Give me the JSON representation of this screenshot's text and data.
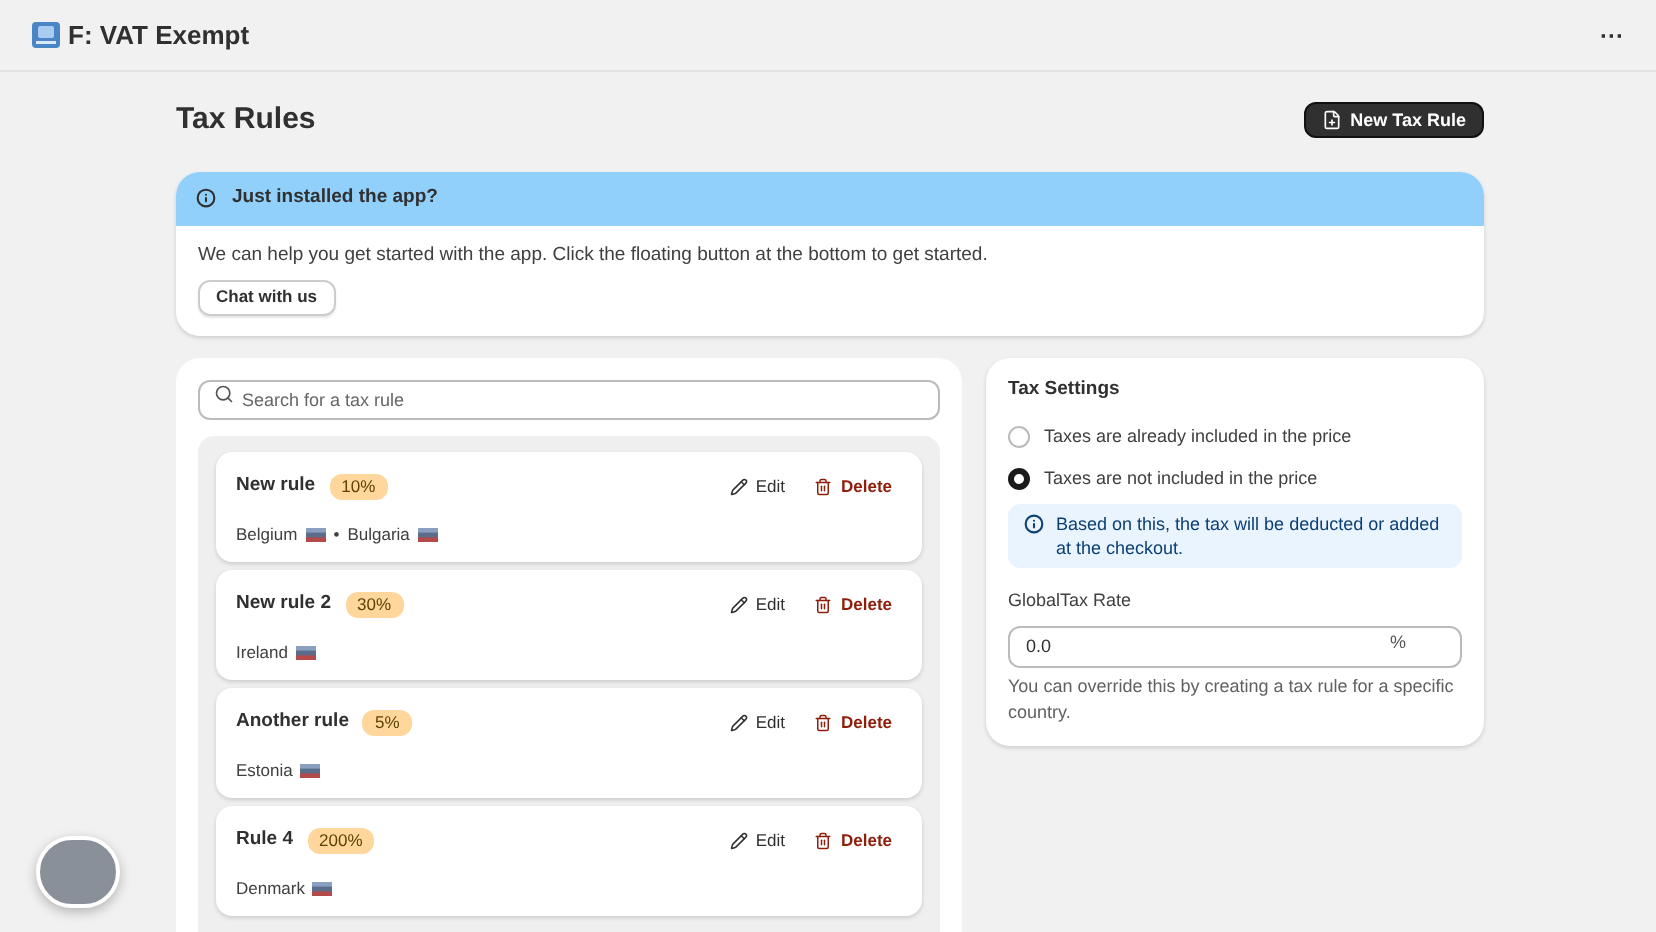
{
  "window": {
    "title": "F: VAT Exempt",
    "menu_icon": "···"
  },
  "page": {
    "title": "Tax Rules",
    "primary_action": "New Tax Rule"
  },
  "banner": {
    "title": "Just installed the app?",
    "body": "We can help you get started with the app. Click the floating button at the bottom to get started.",
    "action": "Chat with us"
  },
  "search": {
    "placeholder": "Search for a tax rule"
  },
  "rules": [
    {
      "name": "New rule",
      "rate": "10%",
      "edit": "Edit",
      "delete": "Delete",
      "countries": [
        "Belgium",
        "Bulgaria"
      ],
      "separators": [
        "•"
      ]
    },
    {
      "name": "New rule 2",
      "rate": "30%",
      "edit": "Edit",
      "delete": "Delete",
      "countries": [
        "Ireland"
      ]
    },
    {
      "name": "Another rule",
      "rate": "5%",
      "edit": "Edit",
      "delete": "Delete",
      "countries": [
        "Estonia"
      ]
    },
    {
      "name": "Rule 4",
      "rate": "200%",
      "edit": "Edit",
      "delete": "Delete",
      "countries": [
        "Denmark"
      ]
    }
  ],
  "settings": {
    "title": "Tax Settings",
    "options": [
      {
        "label": "Taxes are already included in the price",
        "selected": false
      },
      {
        "label": "Taxes are not included in the price",
        "selected": true
      }
    ],
    "notice": "Based on this, the tax will be deducted or added at the checkout.",
    "rate_label": "GlobalTax Rate",
    "rate_value": "0.0",
    "rate_suffix": "%",
    "help": "You can override this by creating a tax rule for a specific country."
  }
}
